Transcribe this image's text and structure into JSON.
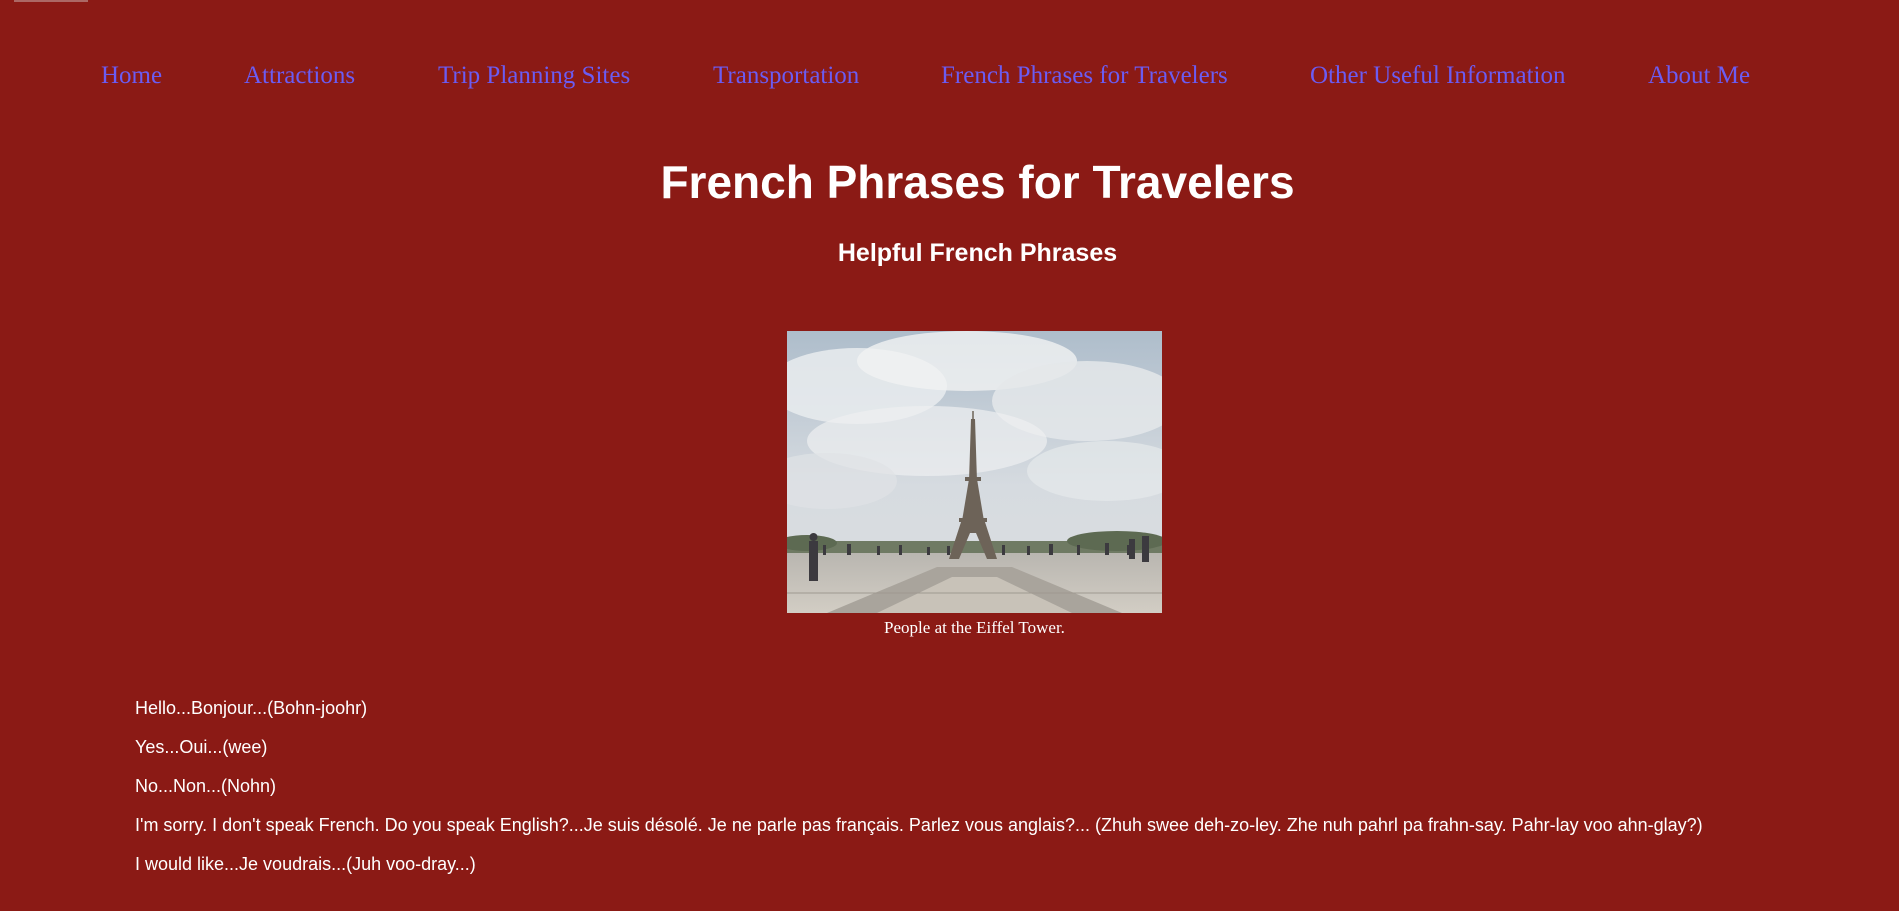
{
  "nav": {
    "items": [
      {
        "label": "Home"
      },
      {
        "label": "Attractions"
      },
      {
        "label": "Trip Planning Sites"
      },
      {
        "label": "Transportation"
      },
      {
        "label": "French Phrases for Travelers"
      },
      {
        "label": "Other Useful Information"
      },
      {
        "label": "About Me"
      }
    ]
  },
  "page": {
    "title": "French Phrases for Travelers",
    "subtitle": "Helpful French Phrases"
  },
  "figure": {
    "caption": "People at the Eiffel Tower."
  },
  "phrases": [
    "Hello...Bonjour...(Bohn-joohr)",
    "Yes...Oui...(wee)",
    "No...Non...(Nohn)",
    "I'm sorry. I don't speak French. Do you speak English?...Je suis désolé. Je ne parle pas français. Parlez vous anglais?... (Zhuh swee deh-zo-ley. Zhe nuh pahrl pa frahn-say. Pahr-lay voo ahn-glay?)",
    "I would like...Je voudrais...(Juh voo-dray...)"
  ],
  "colors": {
    "background": "#8b1a15",
    "nav_link": "#6b5cf2",
    "text": "#ffffff"
  }
}
